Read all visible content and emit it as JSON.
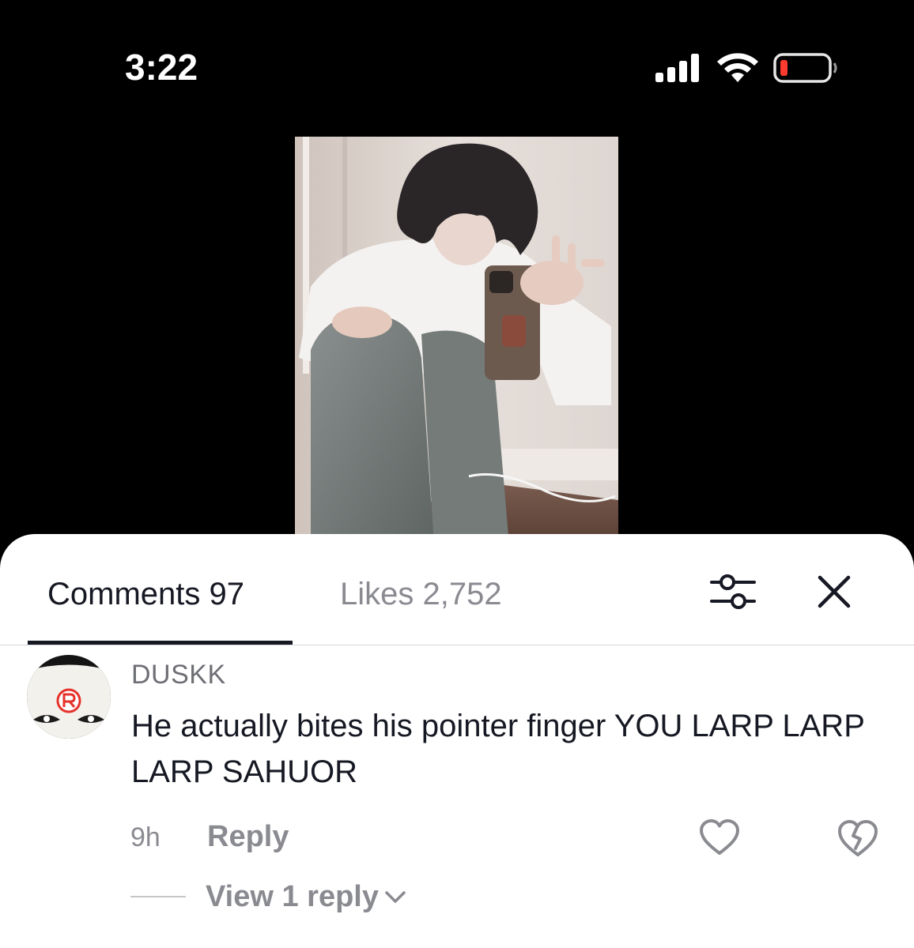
{
  "status_bar": {
    "time": "3:22",
    "battery_color": "#ff3b30"
  },
  "video": {
    "icon": "photo-thumbnail"
  },
  "sheet": {
    "tabs": [
      {
        "label": "Comments 97",
        "active": true
      },
      {
        "label": "Likes 2,752",
        "active": false
      }
    ],
    "filter_icon": "sliders-icon",
    "close_icon": "close-icon"
  },
  "comment": {
    "username": "DUSKK",
    "text": "He actually bites his pointer finger YOU LARP LARP LARP SAHUOR",
    "time": "9h",
    "reply_label": "Reply",
    "view_replies_label": "View 1 reply"
  },
  "colors": {
    "primary_text": "#161823",
    "secondary_text": "#8a8b91",
    "divider": "#d6d6d8"
  }
}
